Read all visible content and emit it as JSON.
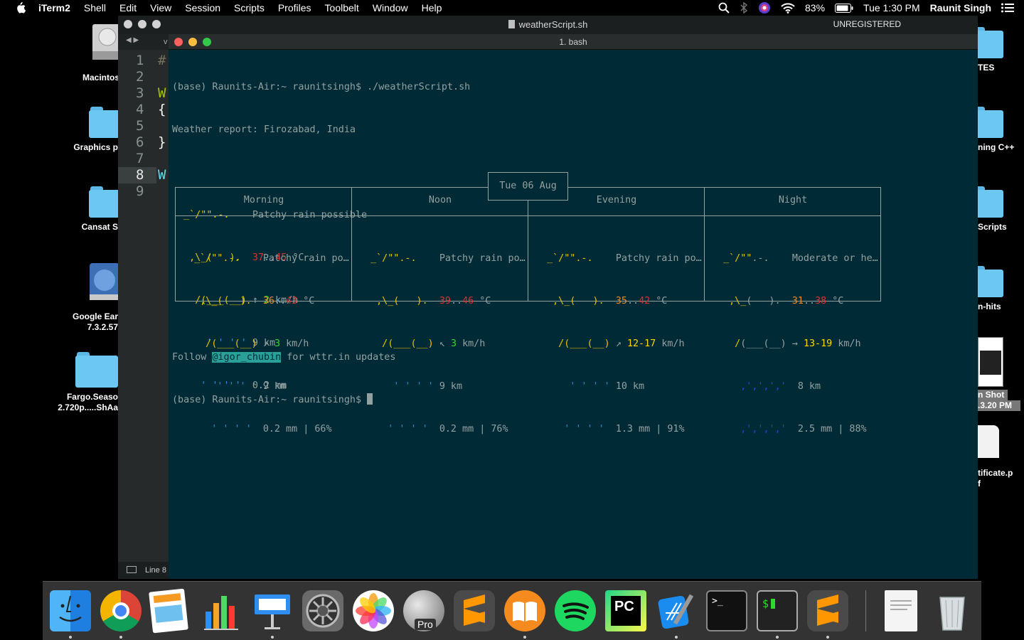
{
  "menubar": {
    "app_name": "iTerm2",
    "items": [
      "Shell",
      "Edit",
      "View",
      "Session",
      "Scripts",
      "Profiles",
      "Toolbelt",
      "Window",
      "Help"
    ],
    "battery": "83%",
    "clock": "Tue 1:30 PM",
    "user": "Raunit Singh"
  },
  "desktop": {
    "left_icons": [
      {
        "label": "Macintos",
        "label2": ""
      },
      {
        "label": "Graphics p",
        "label2": ""
      },
      {
        "label": "Cansat S",
        "label2": ""
      },
      {
        "label": "Google Ear",
        "label2": "7.3.2.57"
      },
      {
        "label": "Fargo.Seaso",
        "label2": "2.720p.....ShAa"
      }
    ],
    "right_icons": [
      {
        "label": "TES",
        "label2": ""
      },
      {
        "label": "ning C++",
        "label2": ""
      },
      {
        "label": "Scripts",
        "label2": ""
      },
      {
        "label": "n-hits",
        "label2": ""
      },
      {
        "label": "n Shot",
        "label2": ".3.20 PM"
      },
      {
        "label": "tificate.p",
        "label2": "f"
      }
    ]
  },
  "sublime": {
    "file_title": "weatherScript.sh",
    "unregistered": "UNREGISTERED",
    "tab_arrows": "◀ ▶",
    "tab_label": "v",
    "line_numbers": [
      "1",
      "2",
      "3",
      "4",
      "5",
      "6",
      "7",
      "8",
      "9"
    ],
    "code_peek": [
      "#",
      "",
      "W",
      "{",
      "",
      "}",
      "",
      "W",
      ""
    ],
    "status": "Line 8"
  },
  "iterm": {
    "window_title": "1. bash",
    "prompt": "(base) Raunits-Air:~ raunitsingh$ ",
    "command": "./weatherScript.sh",
    "report_title": "Weather report: Firozabad, India",
    "current": {
      "condition": "Patchy rain possible",
      "temp_lo": "37",
      "temp_hi": "45",
      "temp_unit": "°C",
      "wind_arrow": "↑",
      "wind": "2",
      "wind_unit": "km/h",
      "visibility": "9 km",
      "precip": "0.2 mm"
    },
    "date_label": "Tue 06 Aug",
    "periods": [
      {
        "name": "Morning",
        "condition": "Patchy rain po…",
        "temp_lo": "36",
        "temp_hi": "43",
        "wind_arrow": "↗",
        "wind": "3",
        "visibility": "9 km",
        "precip": "0.2 mm | 66%"
      },
      {
        "name": "Noon",
        "condition": "Patchy rain po…",
        "temp_lo": "39",
        "temp_hi": "46",
        "wind_arrow": "↖",
        "wind": "3",
        "visibility": "9 km",
        "precip": "0.2 mm | 76%"
      },
      {
        "name": "Evening",
        "condition": "Patchy rain po…",
        "temp_lo": "35",
        "temp_hi": "42",
        "wind_arrow": "↗",
        "wind": "12-17",
        "visibility": "10 km",
        "precip": "1.3 mm | 91%"
      },
      {
        "name": "Night",
        "condition": "Moderate or he…",
        "temp_lo": "31",
        "temp_hi": "38",
        "wind_arrow": "→",
        "wind": "13-19",
        "visibility": "8 km",
        "precip": "2.5 mm | 88%"
      }
    ],
    "follow_prefix": "Follow ",
    "follow_handle": "@igor_chubin",
    "follow_suffix": " for wttr.in updates"
  },
  "dock": {
    "apps": [
      "finder-icon",
      "chrome-icon",
      "pages-icon",
      "numbers-icon",
      "keynote-icon",
      "system-preferences-icon",
      "photos-icon",
      "google-earth-pro-icon",
      "sublime-text-icon",
      "ibooks-icon",
      "spotify-icon",
      "pycharm-icon",
      "xcode-icon",
      "terminal-icon",
      "iterm-icon",
      "sublime-text-2-icon",
      "document-icon",
      "trash-icon"
    ],
    "google_earth_badge": "Pro",
    "pycharm_badge": "PC"
  },
  "colors": {
    "terminal_bg": "#002b36",
    "terminal_fg": "#93a1a1",
    "cloud_yellow": "#e5c400",
    "rain_blue": "#268bd2",
    "temp_red": "#dc322f",
    "temp_orange": "#f0891c",
    "wind_green": "#2ed82e",
    "wind_yellow": "#ffd800",
    "link_highlight": "#2aa198"
  }
}
